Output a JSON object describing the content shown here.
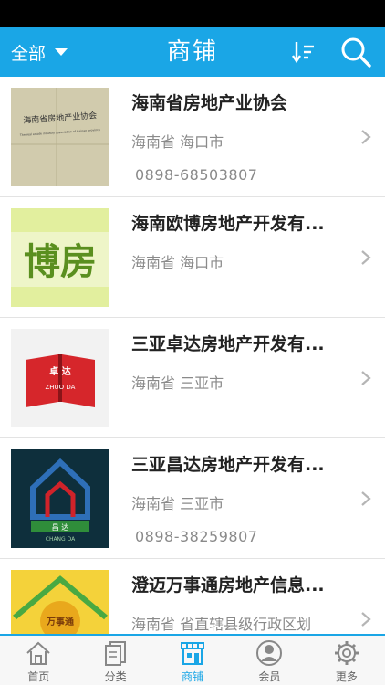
{
  "header": {
    "filter_label": "全部",
    "title": "商铺",
    "sort_icon": "sort-icon",
    "search_icon": "search-icon",
    "color": "#1aa6e6"
  },
  "shops": [
    {
      "name": "海南省房地产业协会",
      "region": "海南省 海口市",
      "phone": "0898-68503807",
      "thumb_text": "海南省房地产业协会",
      "thumb_subtext": "The real estate industry association of Hainan province"
    },
    {
      "name": "海南欧博房地产开发有...",
      "region": "海南省 海口市",
      "phone": "",
      "thumb_text": "博房"
    },
    {
      "name": "三亚卓达房地产开发有...",
      "region": "海南省 三亚市",
      "phone": "",
      "thumb_text": "卓 达",
      "thumb_subtext": "ZHUO DA"
    },
    {
      "name": "三亚昌达房地产开发有...",
      "region": "海南省 三亚市",
      "phone": "0898-38259807",
      "thumb_text": "昌 达",
      "thumb_subtext": "CHANG DA"
    },
    {
      "name": "澄迈万事通房地产信息...",
      "region": "海南省 省直辖县级行政区划",
      "phone": "",
      "thumb_text": "万事通"
    }
  ],
  "tabs": [
    {
      "label": "首页",
      "icon": "home-icon"
    },
    {
      "label": "分类",
      "icon": "category-icon"
    },
    {
      "label": "商铺",
      "icon": "shop-icon",
      "active": true
    },
    {
      "label": "会员",
      "icon": "member-icon"
    },
    {
      "label": "更多",
      "icon": "more-icon"
    }
  ]
}
